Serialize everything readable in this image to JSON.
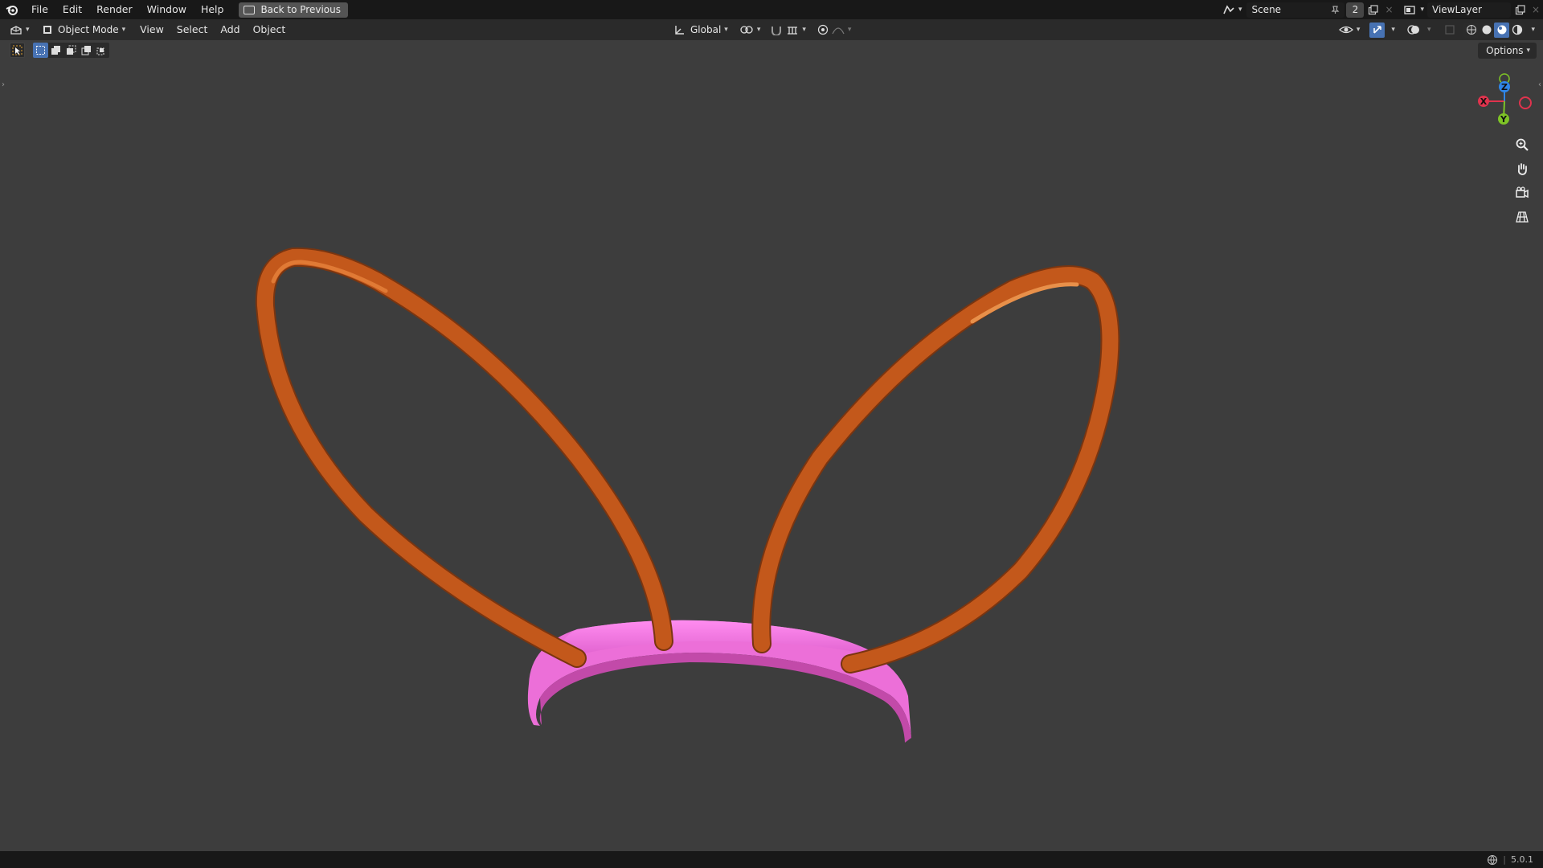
{
  "topbar": {
    "menu": [
      "File",
      "Edit",
      "Render",
      "Window",
      "Help"
    ],
    "back_label": "Back to Previous",
    "scene_name": "Scene",
    "scene_users": "2",
    "view_layer": "ViewLayer"
  },
  "header": {
    "mode": "Object Mode",
    "menus": [
      "View",
      "Select",
      "Add",
      "Object"
    ],
    "orientation": "Global"
  },
  "options_label": "Options",
  "gizmo": {
    "z": "Z",
    "x": "X",
    "y": "Y"
  },
  "status": {
    "version": "5.0.1"
  },
  "colors": {
    "ear": "#c3581b",
    "ear_highlight": "#e07a35",
    "ear_shadow": "#7a3510",
    "band": "#f070d9",
    "band_shadow": "#c24aa9",
    "x_axis": "#e0334d",
    "y_axis": "#7ec426",
    "z_axis": "#2f86e8",
    "select_accent": "#4772b3"
  },
  "icons": [
    "blender-logo",
    "editor-type-icon",
    "object-mode-icon",
    "transform-orientation-icon",
    "pivot-icon",
    "snap-icon",
    "proportional-icon",
    "visibility-icon",
    "gizmo-icon",
    "overlay-icon",
    "xray-icon",
    "wireframe-shading-icon",
    "solid-shading-icon",
    "material-shading-icon",
    "rendered-shading-icon",
    "zoom-icon",
    "hand-pan-icon",
    "camera-icon",
    "grid-icon"
  ]
}
